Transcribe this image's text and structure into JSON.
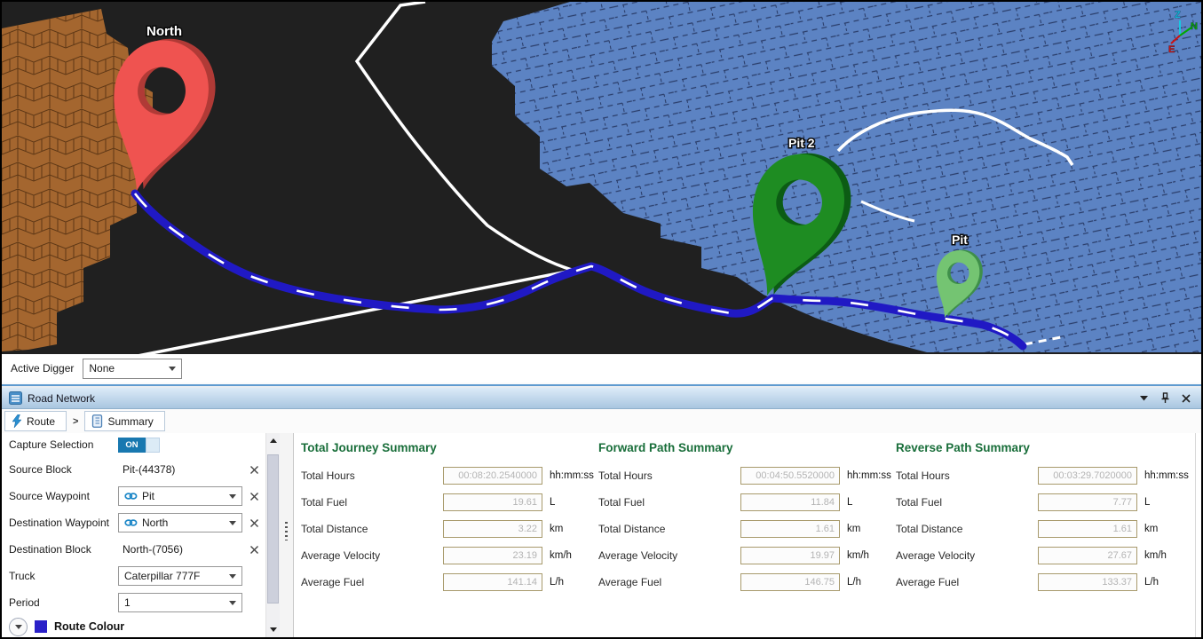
{
  "scene": {
    "pins": [
      {
        "label": "North",
        "color": "#ef5350"
      },
      {
        "label": "Pit 2",
        "color": "#1e8c22"
      },
      {
        "label": "Pit",
        "color": "#74c472"
      }
    ],
    "axis": {
      "z": "Z",
      "n": "N",
      "e": "E"
    }
  },
  "active_digger": {
    "label": "Active Digger",
    "value": "None"
  },
  "panel": {
    "title": "Road Network"
  },
  "toolbar": {
    "route": "Route",
    "separator": ">",
    "summary": "Summary"
  },
  "form": {
    "capture": {
      "label": "Capture Selection",
      "state": "ON"
    },
    "source_block": {
      "label": "Source Block",
      "value": "Pit-(44378)"
    },
    "source_waypoint": {
      "label": "Source Waypoint",
      "value": "Pit"
    },
    "destination_waypoint": {
      "label": "Destination Waypoint",
      "value": "North"
    },
    "destination_block": {
      "label": "Destination Block",
      "value": "North-(7056)"
    },
    "truck": {
      "label": "Truck",
      "value": "Caterpillar 777F"
    },
    "period": {
      "label": "Period",
      "value": "1"
    },
    "route_colour": {
      "label": "Route Colour",
      "swatch_color": "#2a20c8"
    }
  },
  "summaries": [
    {
      "heading": "Total Journey Summary",
      "rows": [
        {
          "label": "Total Hours",
          "value": "00:08:20.2540000",
          "unit": "hh:mm:ss"
        },
        {
          "label": "Total Fuel",
          "value": "19.61",
          "unit": "L"
        },
        {
          "label": "Total Distance",
          "value": "3.22",
          "unit": "km"
        },
        {
          "label": "Average Velocity",
          "value": "23.19",
          "unit": "km/h"
        },
        {
          "label": "Average Fuel",
          "value": "141.14",
          "unit": "L/h"
        }
      ]
    },
    {
      "heading": "Forward Path Summary",
      "rows": [
        {
          "label": "Total Hours",
          "value": "00:04:50.5520000",
          "unit": "hh:mm:ss"
        },
        {
          "label": "Total Fuel",
          "value": "11.84",
          "unit": "L"
        },
        {
          "label": "Total Distance",
          "value": "1.61",
          "unit": "km"
        },
        {
          "label": "Average Velocity",
          "value": "19.97",
          "unit": "km/h"
        },
        {
          "label": "Average Fuel",
          "value": "146.75",
          "unit": "L/h"
        }
      ]
    },
    {
      "heading": "Reverse Path Summary",
      "rows": [
        {
          "label": "Total Hours",
          "value": "00:03:29.7020000",
          "unit": "hh:mm:ss"
        },
        {
          "label": "Total Fuel",
          "value": "7.77",
          "unit": "L"
        },
        {
          "label": "Total Distance",
          "value": "1.61",
          "unit": "km"
        },
        {
          "label": "Average Velocity",
          "value": "27.67",
          "unit": "km/h"
        },
        {
          "label": "Average Fuel",
          "value": "133.37",
          "unit": "L/h"
        }
      ]
    }
  ],
  "colors": {
    "route": "#2019c4",
    "terrain_blue": "#5c83c3",
    "terrain_brown": "#a4662f",
    "toggle_on": "#1878b0",
    "heading_green": "#196e3a",
    "input_border": "#a89a6c"
  }
}
